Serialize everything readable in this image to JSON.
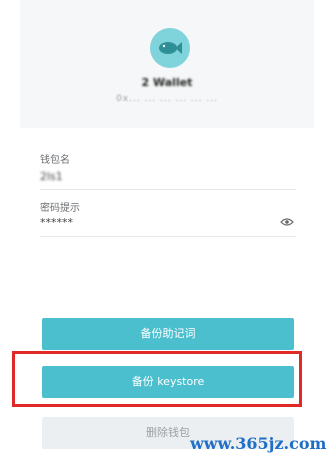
{
  "wallet": {
    "name": "2 Wallet",
    "address": "0x... ... ... ... ... ..."
  },
  "form": {
    "wallet_name_label": "钱包名",
    "wallet_name_value": "2ls1",
    "password_hint_label": "密码提示",
    "password_hint_value": "******"
  },
  "buttons": {
    "backup_mnemonic": "备份助记词",
    "backup_keystore": "备份 keystore",
    "delete_wallet": "删除钱包"
  },
  "watermark": "www.365jz.com",
  "colors": {
    "accent": "#4cbfcf",
    "highlight": "#e02a2a",
    "watermark": "#1f6fc8"
  }
}
